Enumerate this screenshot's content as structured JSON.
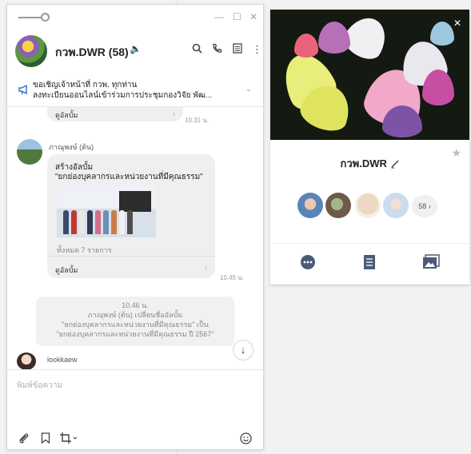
{
  "chat": {
    "room_name": "กวพ.DWR (58)",
    "announcement": {
      "line1": "ขอเชิญเจ้าหน้าที่ กวพ. ทุกท่าน",
      "line2": "ลงทะเบียนออนไลน์เข้าร่วมการประชุมกองวิจัย พัฒ..."
    },
    "messages": [
      {
        "type": "album_tail",
        "album_label": "ดูอัลบั้ม",
        "time": "10.31 น."
      },
      {
        "type": "album",
        "sender": "ภาณุพงษ์ (ต้น)",
        "line1": "สร้างอัลบั้ม",
        "line2": "\"ยกย่องบุคลากรและหน่วยงานที่มีคุณธรรม\"",
        "count": "ทั้งหมด 7 รายการ",
        "album_label": "ดูอัลบั้ม",
        "time": "10.45 น."
      },
      {
        "type": "system",
        "lines": [
          "10.46 น.",
          "ภาณุพงษ์ (ต้น) เปลี่ยนชื่ออัลบั้ม",
          "\"ยกย่องบุคลากรและหน่วยงานที่มีคุณธรรม\" เป็น",
          "\"ยกย่องบุคลากรและหน่วยงานที่มีคุณธรรม ปี 2567\""
        ]
      },
      {
        "type": "typing",
        "sender": "lookkaew"
      }
    ],
    "input_placeholder": "พิมพ์ข้อความ"
  },
  "profile": {
    "name": "กวพ.DWR",
    "member_count": "58 ›"
  },
  "colors": {
    "accent": "#2a6fdc",
    "icon_blue": "#4b5b7a"
  }
}
